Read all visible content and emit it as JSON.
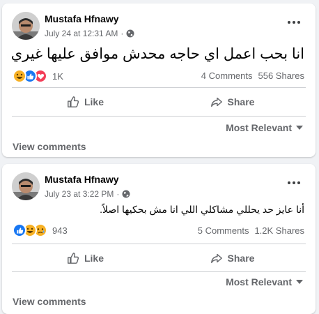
{
  "posts": [
    {
      "author": "Mustafa Hfnawy",
      "timestamp": "July 24 at 12:31 AM",
      "separator": "·",
      "privacy_icon": "globe-icon",
      "text": "انا بحب اعمل اي حاجه محدش موافق عليها غيري",
      "reactions": [
        "haha",
        "like",
        "love"
      ],
      "reaction_count": "1K",
      "comments": "4 Comments",
      "shares": "556 Shares",
      "like_label": "Like",
      "share_label": "Share",
      "sort_label": "Most Relevant",
      "view_comments": "View comments"
    },
    {
      "author": "Mustafa Hfnawy",
      "timestamp": "July 23 at 3:22 PM",
      "separator": "·",
      "privacy_icon": "globe-icon",
      "text": "أنا عايز حد يحللي مشاكلي اللي انا مش بحكيها اصلاً.",
      "reactions": [
        "like",
        "haha",
        "sad"
      ],
      "reaction_count": "943",
      "comments": "5 Comments",
      "shares": "1.2K Shares",
      "like_label": "Like",
      "share_label": "Share",
      "sort_label": "Most Relevant",
      "view_comments": "View comments"
    }
  ],
  "colors": {
    "like": "#1877f2",
    "love": "#f33e58",
    "haha": "#f7b125",
    "sad": "#f7b125",
    "secondary_text": "#65676b",
    "background": "#f0f2f5"
  }
}
